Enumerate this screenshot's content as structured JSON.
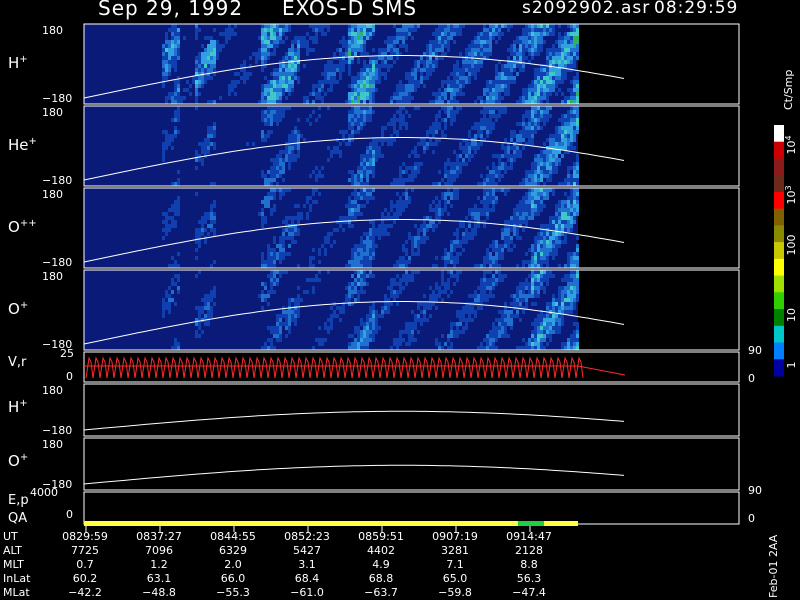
{
  "header": {
    "date": "Sep 29, 1992",
    "instrument": "EXOS-D SMS",
    "file": "s2092902.asr",
    "time": "08:29:59"
  },
  "panels": [
    {
      "id": "h-plus",
      "species": "H",
      "charge": "+",
      "ymax": "180",
      "ymin": "−180"
    },
    {
      "id": "he-plus",
      "species": "He",
      "charge": "+",
      "ymax": "180",
      "ymin": "−180"
    },
    {
      "id": "o-plusplus",
      "species": "O",
      "charge": "++",
      "ymax": "180",
      "ymin": "−180"
    },
    {
      "id": "o-plus",
      "species": "O",
      "charge": "+",
      "ymax": "180",
      "ymin": "−180"
    }
  ],
  "vr_panel": {
    "label": "V,r",
    "ymax": "25",
    "ymin": "0",
    "right_max": "90",
    "right_min": "0"
  },
  "line_panels": [
    {
      "id": "h-line",
      "species": "H",
      "charge": "+",
      "ymax": "180",
      "ymin": "−180"
    },
    {
      "id": "o-line",
      "species": "O",
      "charge": "+",
      "ymax": "180",
      "ymin": "−180"
    }
  ],
  "ep_panel": {
    "label": "E,p",
    "ymax": "4000",
    "right_max": "90"
  },
  "qa_panel": {
    "label": "QA",
    "ymin": "0",
    "right_min": "0"
  },
  "colorbar": {
    "unit": "Ct/Smp",
    "ticks": [
      {
        "base": "10",
        "exp": "4"
      },
      {
        "base": "10",
        "exp": "3"
      },
      {
        "base": "100",
        "exp": ""
      },
      {
        "base": "10",
        "exp": ""
      },
      {
        "base": "1",
        "exp": ""
      }
    ],
    "colors": [
      "#ffffff",
      "#cc0000",
      "#8b1a1a",
      "#6b2a1a",
      "#ff0000",
      "#806000",
      "#8a8a00",
      "#c8c800",
      "#ffff00",
      "#a0e000",
      "#30d000",
      "#008000",
      "#00c8c8",
      "#0080ff",
      "#0000a0"
    ]
  },
  "orbit": {
    "labels": [
      "UT",
      "ALT",
      "MLT",
      "InLat",
      "MLat"
    ],
    "columns": [
      [
        "0829:59",
        "7725",
        "0.7",
        "60.2",
        "−42.2"
      ],
      [
        "0837:27",
        "7096",
        "1.2",
        "63.1",
        "−48.8"
      ],
      [
        "0844:55",
        "6329",
        "2.0",
        "66.0",
        "−55.3"
      ],
      [
        "0852:23",
        "5427",
        "3.1",
        "68.4",
        "−61.0"
      ],
      [
        "0859:51",
        "4402",
        "4.9",
        "68.8",
        "−63.7"
      ],
      [
        "0907:19",
        "3281",
        "7.1",
        "65.0",
        "−59.8"
      ],
      [
        "0914:47",
        "2128",
        "8.8",
        "56.3",
        "−47.4"
      ]
    ]
  },
  "footer": {
    "date": "Feb-01 2AA"
  },
  "colors": {
    "background": "#000000",
    "spectrogram_bg": "#0a1a78",
    "vr_trace": "#ff2a2a",
    "qa_good": "#ffff40",
    "qa_green": "#20d040"
  }
}
